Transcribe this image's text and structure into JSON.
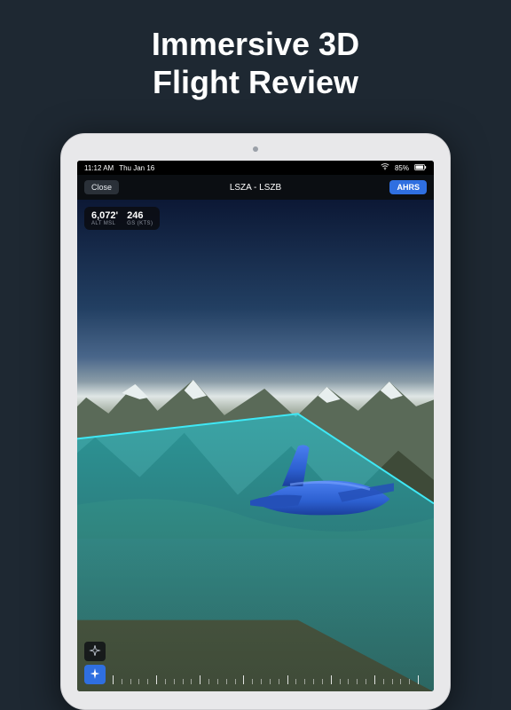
{
  "headline_line1": "Immersive 3D",
  "headline_line2": "Flight Review",
  "ios_status": {
    "time": "11:12 AM",
    "date": "Thu Jan 16",
    "battery": "85%"
  },
  "app_bar": {
    "close_label": "Close",
    "route": "LSZA - LSZB",
    "ahrs_label": "AHRS"
  },
  "telemetry": {
    "alt_value": "6,072'",
    "alt_label": "ALT MSL",
    "gs_value": "246",
    "gs_label": "GS (KTS)"
  },
  "colors": {
    "accent_blue": "#2f6fe0",
    "ribbon_cyan": "#18c6d9",
    "aircraft_blue": "#2c63d6",
    "bg": "#1e2832"
  },
  "bottom_controls": {
    "toggle_top": "plane-outline-icon",
    "toggle_bottom": "plane-filled-icon"
  }
}
